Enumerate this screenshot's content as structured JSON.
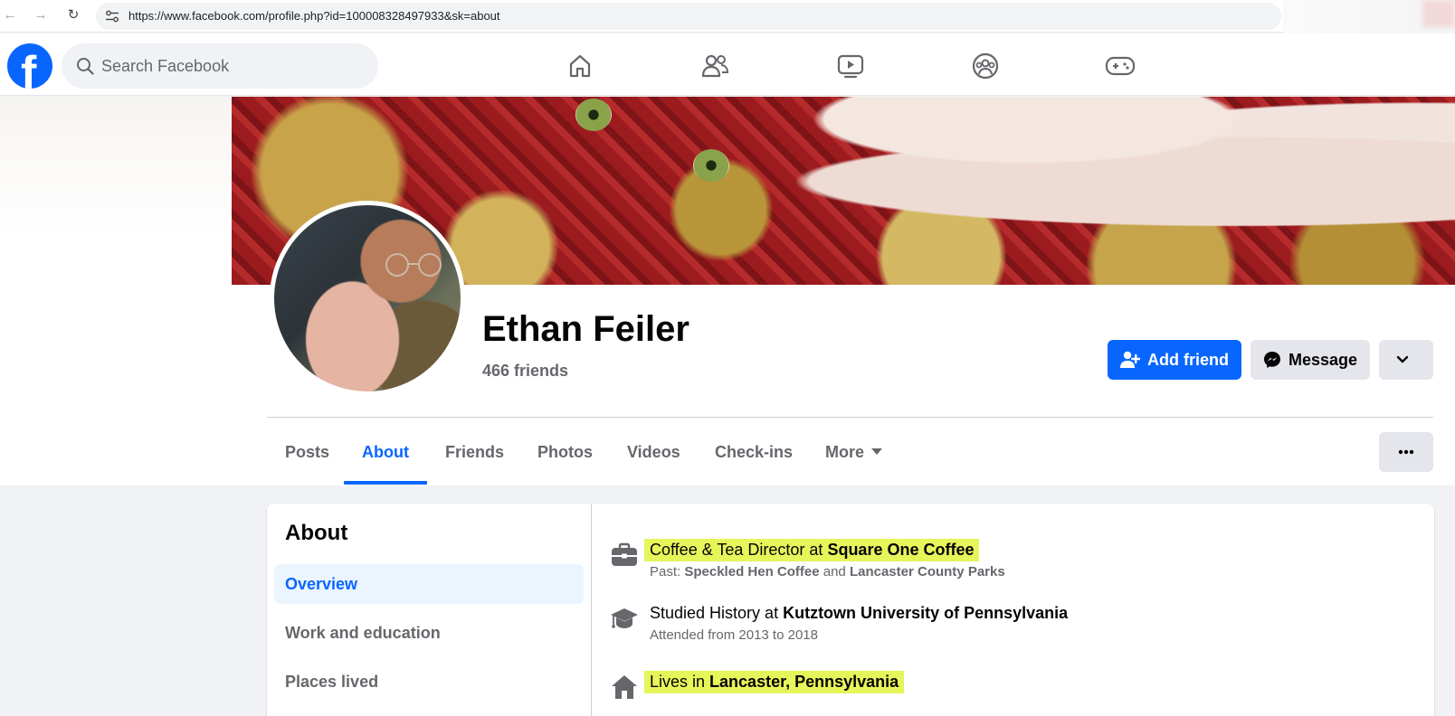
{
  "browser": {
    "url": "https://www.facebook.com/profile.php?id=100008328497933&sk=about"
  },
  "topbar": {
    "logo_letter": "f",
    "search_placeholder": "Search Facebook",
    "nav_icons": [
      "home-icon",
      "friends-icon",
      "watch-icon",
      "groups-icon",
      "gaming-icon"
    ]
  },
  "profile": {
    "name": "Ethan Feiler",
    "friends": "466 friends",
    "add_friend_label": "Add friend",
    "message_label": "Message"
  },
  "tabs": [
    {
      "label": "Posts",
      "active": false
    },
    {
      "label": "About",
      "active": true
    },
    {
      "label": "Friends",
      "active": false
    },
    {
      "label": "Photos",
      "active": false
    },
    {
      "label": "Videos",
      "active": false
    },
    {
      "label": "Check-ins",
      "active": false
    },
    {
      "label": "More",
      "active": false
    }
  ],
  "about": {
    "title": "About",
    "sidebar": [
      {
        "label": "Overview",
        "active": true
      },
      {
        "label": "Work and education",
        "active": false
      },
      {
        "label": "Places lived",
        "active": false
      }
    ],
    "work": {
      "role": "Coffee & Tea Director at ",
      "employer": "Square One Coffee",
      "past_prefix": "Past: ",
      "past_1": "Speckled Hen Coffee",
      "past_and": " and ",
      "past_2": "Lancaster County Parks"
    },
    "education": {
      "prefix": "Studied History at ",
      "school": "Kutztown University of Pennsylvania",
      "attended": "Attended from 2013 to 2018"
    },
    "lives": {
      "prefix": "Lives in ",
      "place": "Lancaster, Pennsylvania"
    }
  },
  "colors": {
    "brand_blue": "#0866ff",
    "highlight": "#e6f55a",
    "secondary_text": "#65676b"
  }
}
